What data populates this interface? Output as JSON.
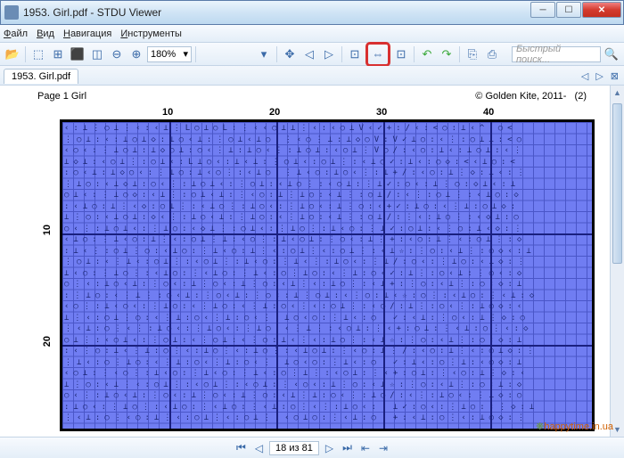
{
  "window": {
    "title": "1953. Girl.pdf - STDU Viewer"
  },
  "menu": {
    "file": "Файл",
    "view": "Вид",
    "nav": "Навигация",
    "tools": "Инструменты"
  },
  "toolbar": {
    "zoom": "180%",
    "search_placeholder": "Быстрый поиск..."
  },
  "tab": {
    "label": "1953. Girl.pdf"
  },
  "page": {
    "left": "Page 1  Girl",
    "right_copyright": "© Golden Kite, 2011-",
    "right_num": "(2)"
  },
  "grid": {
    "top_labels": {
      "c10": "10",
      "c20": "20",
      "c30": "30",
      "c40": "40"
    },
    "left_labels": {
      "r10": "10",
      "r20": "20"
    }
  },
  "status": {
    "page_info": "18 из 81"
  },
  "watermark": {
    "t1": "❋",
    "t2": "happytime.in.ua"
  }
}
